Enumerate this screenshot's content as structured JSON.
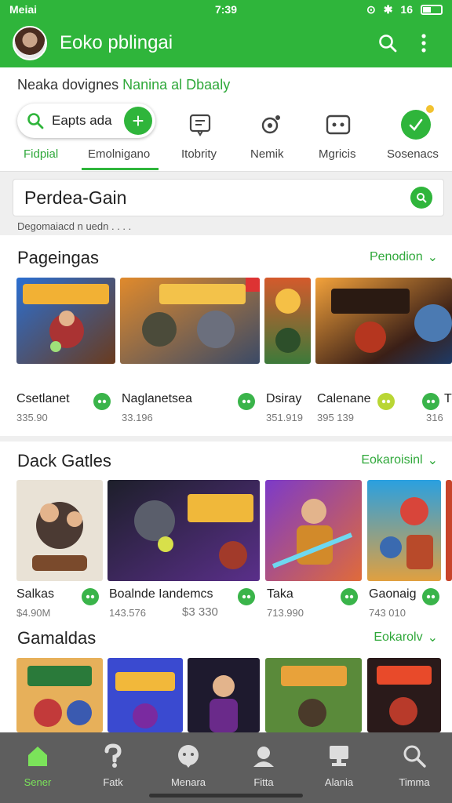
{
  "status": {
    "carrier": "Meiai",
    "time": "7:39",
    "indicators": "16"
  },
  "appbar": {
    "title": "Eoko pblingai",
    "search_icon": "search-icon",
    "menu_icon": "more-vert-icon"
  },
  "subtitle": {
    "main": "Neaka dovignes",
    "accent": "Nanina al Dbaaly"
  },
  "chip": {
    "label": "Eapts ada"
  },
  "tabs": [
    "Fidpial",
    "Emolnigano",
    "Itobrity",
    "Nemik",
    "Mgricis",
    "Sosenacs"
  ],
  "search": {
    "value": "Perdea-Gain"
  },
  "hint": "Degomaiacd n uedn . . . .",
  "sections": [
    {
      "title": "Pageingas",
      "link": "Penodion",
      "items": [
        {
          "name": "Csetlanet",
          "price": "335.90"
        },
        {
          "name": "Naglanetsea",
          "price": "33.196"
        },
        {
          "name": "Dsiray",
          "price": "351.919"
        },
        {
          "name": "Calenane",
          "price": "395 139"
        },
        {
          "name": "T",
          "price": "316"
        }
      ]
    },
    {
      "title": "Dack Gatles",
      "link": "Eokaroisinl",
      "items": [
        {
          "name": "Salkas",
          "price": "$4.90M"
        },
        {
          "name": "Boalnde Iandemcs",
          "price": "143.576",
          "price2": "$3 330"
        },
        {
          "name": "Taka",
          "price": "713.990"
        },
        {
          "name": "Gaonaig",
          "price": "743 010"
        }
      ]
    },
    {
      "title": "Gamaldas",
      "link": "Eokarolv"
    }
  ],
  "nav": [
    {
      "label": "Sener",
      "icon": "home-icon",
      "active": true
    },
    {
      "label": "Fatk",
      "icon": "help-icon"
    },
    {
      "label": "Menara",
      "icon": "chat-icon"
    },
    {
      "label": "Fitta",
      "icon": "user-icon"
    },
    {
      "label": "Alania",
      "icon": "computer-icon"
    },
    {
      "label": "Timma",
      "icon": "search-icon"
    }
  ],
  "colors": {
    "primary": "#2fb53b",
    "accent_text": "#2fa83a",
    "nav_bg": "#5e5e5e"
  }
}
